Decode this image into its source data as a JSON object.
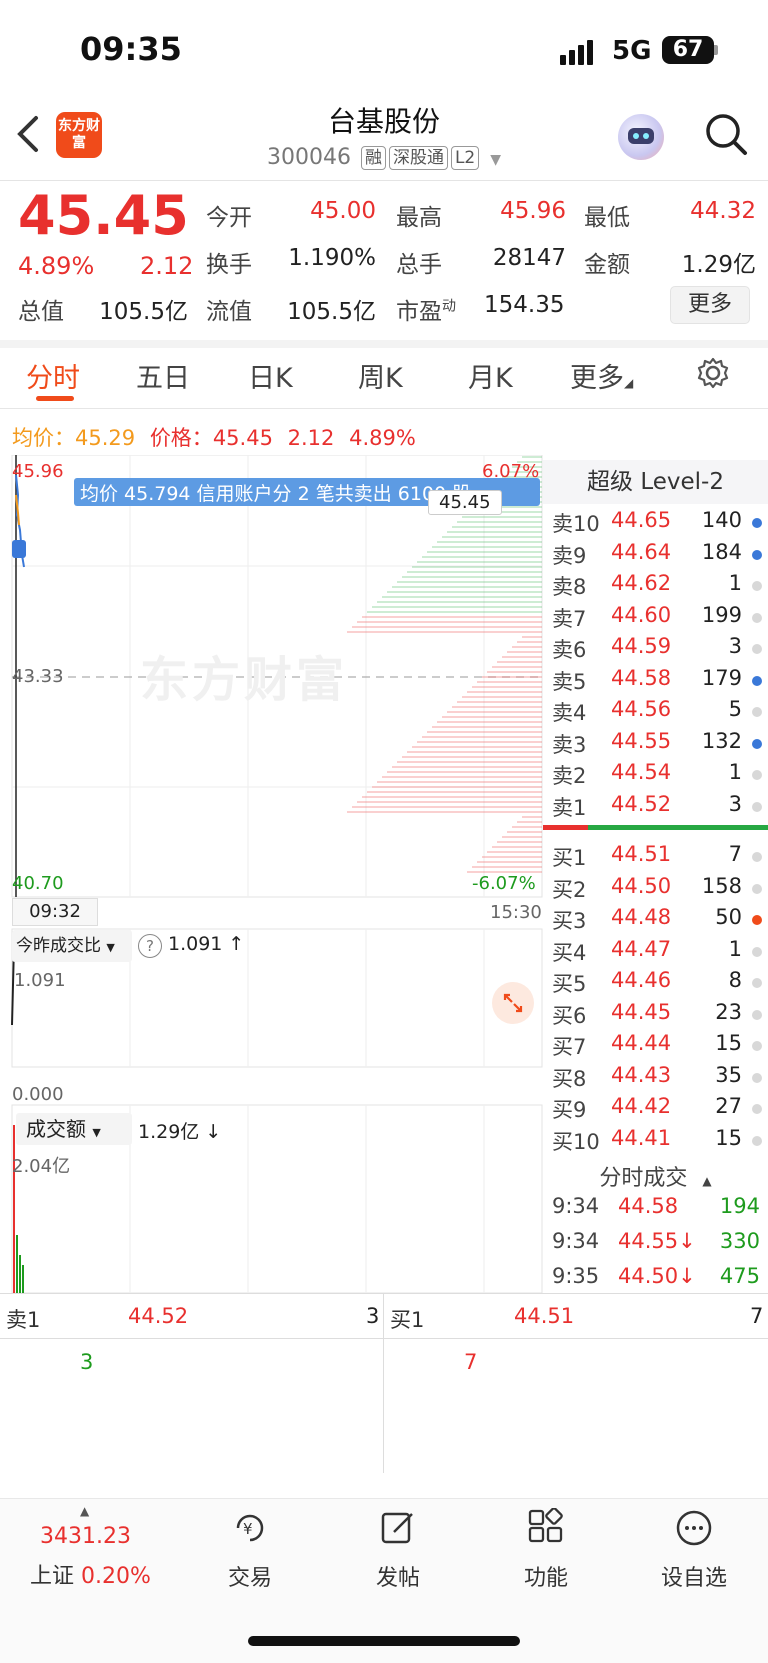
{
  "status_bar": {
    "time": "09:35",
    "network": "5G",
    "battery": "67"
  },
  "header": {
    "logo_text": "东方财富",
    "stock_name": "台基股份",
    "stock_code": "300046",
    "tags": [
      "融",
      "深股通",
      "L2"
    ]
  },
  "quote": {
    "price": "45.45",
    "change_pct": "4.89%",
    "change": "2.12",
    "fields": [
      {
        "label": "今开",
        "value": "45.00",
        "color": "#e8302e"
      },
      {
        "label": "最高",
        "value": "45.96",
        "color": "#e8302e"
      },
      {
        "label": "最低",
        "value": "44.32",
        "color": "#e8302e"
      },
      {
        "label": "换手",
        "value": "1.190%",
        "color": "#222"
      },
      {
        "label": "总手",
        "value": "28147",
        "color": "#222"
      },
      {
        "label": "金额",
        "value": "1.29亿",
        "color": "#222"
      },
      {
        "label": "总值",
        "value": "105.5亿",
        "color": "#222"
      },
      {
        "label": "流值",
        "value": "105.5亿",
        "color": "#222"
      },
      {
        "label": "市盈",
        "sup": "动",
        "value": "154.35",
        "color": "#222"
      }
    ],
    "more_button": "更多"
  },
  "tabs": [
    "分时",
    "五日",
    "日K",
    "周K",
    "月K",
    "更多"
  ],
  "avg_line": {
    "avg_label": "均价：",
    "avg_value": "45.29",
    "price_label": "价格：",
    "price_value": "45.45",
    "change": "2.12",
    "change_pct": "4.89%"
  },
  "chart": {
    "y_max": "45.96",
    "y_max_pct": "6.07%",
    "y_mid": "43.33",
    "y_min": "40.70",
    "y_min_pct": "-6.07%",
    "tooltip": "均价 45.794  信用账户分 2 笔共卖出 6100 股",
    "current_price_box": "45.45",
    "time_start": "09:32",
    "time_end": "15:30",
    "watermark": "东方财富",
    "ratio_selector": "今昨成交比",
    "ratio_value": "1.091 ↑",
    "ratio_top": "1.091",
    "ratio_bottom": "0.000",
    "amount_selector": "成交额",
    "amount_value": "1.29亿 ↓",
    "amount_top": "2.04亿"
  },
  "level2": {
    "title": "超级 Level-2",
    "asks": [
      {
        "label": "卖10",
        "price": "44.65",
        "vol": "140",
        "dot": "blue"
      },
      {
        "label": "卖9",
        "price": "44.64",
        "vol": "184",
        "dot": "blue"
      },
      {
        "label": "卖8",
        "price": "44.62",
        "vol": "1",
        "dot": "gray"
      },
      {
        "label": "卖7",
        "price": "44.60",
        "vol": "199",
        "dot": "gray"
      },
      {
        "label": "卖6",
        "price": "44.59",
        "vol": "3",
        "dot": "gray"
      },
      {
        "label": "卖5",
        "price": "44.58",
        "vol": "179",
        "dot": "blue"
      },
      {
        "label": "卖4",
        "price": "44.56",
        "vol": "5",
        "dot": "gray"
      },
      {
        "label": "卖3",
        "price": "44.55",
        "vol": "132",
        "dot": "blue"
      },
      {
        "label": "卖2",
        "price": "44.54",
        "vol": "1",
        "dot": "gray"
      },
      {
        "label": "卖1",
        "price": "44.52",
        "vol": "3",
        "dot": "gray"
      }
    ],
    "bids": [
      {
        "label": "买1",
        "price": "44.51",
        "vol": "7",
        "dot": "gray"
      },
      {
        "label": "买2",
        "price": "44.50",
        "vol": "158",
        "dot": "gray"
      },
      {
        "label": "买3",
        "price": "44.48",
        "vol": "50",
        "dot": "orange"
      },
      {
        "label": "买4",
        "price": "44.47",
        "vol": "1",
        "dot": "gray"
      },
      {
        "label": "买5",
        "price": "44.46",
        "vol": "8",
        "dot": "gray"
      },
      {
        "label": "买6",
        "price": "44.45",
        "vol": "23",
        "dot": "gray"
      },
      {
        "label": "买7",
        "price": "44.44",
        "vol": "15",
        "dot": "gray"
      },
      {
        "label": "买8",
        "price": "44.43",
        "vol": "35",
        "dot": "gray"
      },
      {
        "label": "买9",
        "price": "44.42",
        "vol": "27",
        "dot": "gray"
      },
      {
        "label": "买10",
        "price": "44.41",
        "vol": "15",
        "dot": "gray"
      }
    ],
    "ticks_title": "分时成交",
    "ticks": [
      {
        "time": "9:34",
        "price": "44.58",
        "vol": "194",
        "color": "#1e9b1e"
      },
      {
        "time": "9:34",
        "price": "44.55↓",
        "vol": "330",
        "color": "#1e9b1e"
      },
      {
        "time": "9:35",
        "price": "44.50↓",
        "vol": "475",
        "color": "#1e9b1e"
      }
    ]
  },
  "split": {
    "sell_label": "卖1",
    "sell_price": "44.52",
    "sell_vol": "3",
    "sell_detail": "3",
    "buy_label": "买1",
    "buy_price": "44.51",
    "buy_vol": "7",
    "buy_detail": "7"
  },
  "bottom_nav": {
    "index_value": "3431.23",
    "index_name": "上证",
    "index_change": "0.20%",
    "items": [
      "交易",
      "发帖",
      "功能",
      "设自选"
    ]
  },
  "colors": {
    "up": "#e8302e",
    "down": "#1e9b1e",
    "accent": "#f04b1a",
    "blue": "#3a78d8"
  }
}
